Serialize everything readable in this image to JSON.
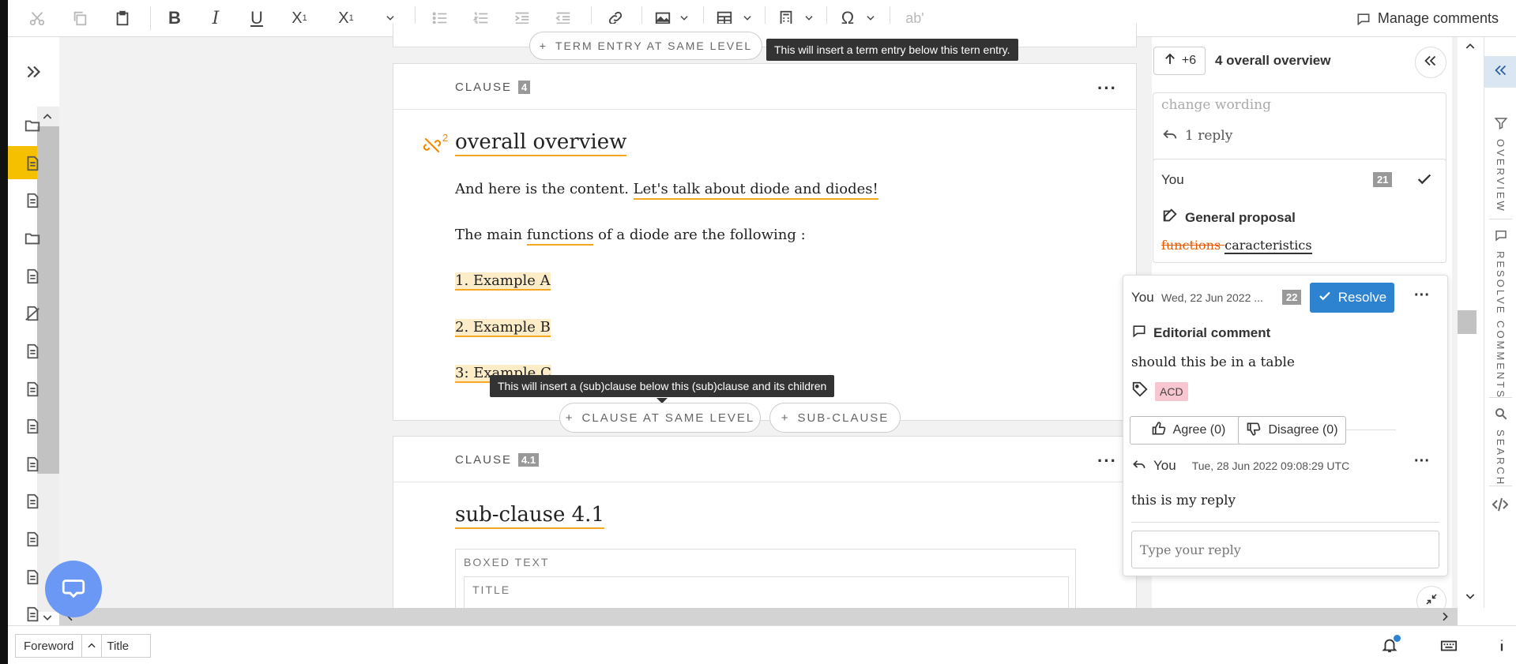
{
  "toolbar": {
    "manage_comments": "Manage comments",
    "superscript_mark": "1",
    "ab_mark": "ab'",
    "items": [
      "cut-icon",
      "copy-icon",
      "paste-icon",
      "bold-icon",
      "italic-icon",
      "underline-icon",
      "subscript-icon",
      "superscript-icon",
      "more-icon",
      "bullet-list-icon",
      "numbered-list-icon",
      "indent-icon",
      "outdent-icon",
      "link-icon",
      "image-icon",
      "table-icon",
      "calculator-icon",
      "special-char-icon",
      "spellcheck-icon"
    ]
  },
  "editor": {
    "term_entry_button": "TERM ENTRY AT SAME LEVEL",
    "term_tooltip": "This will insert a term entry below this tern entry.",
    "clause4": {
      "label": "CLAUSE",
      "number": "4",
      "link_mark": "2",
      "title": "overall overview",
      "p1_plain": "And here is the content. ",
      "p1_highlight": "Let's talk about diode and diodes!",
      "p2_before": "The main ",
      "p2_highlight": "functions",
      "p2_after": " of a diode are the following :",
      "items": [
        "1. Example A",
        "2. Example B",
        "3: Example C"
      ],
      "tooltip": "This will insert a (sub)clause below this (sub)clause and its children",
      "btn_same_level": "CLAUSE AT SAME LEVEL",
      "btn_sub": "SUB-CLAUSE"
    },
    "clause41": {
      "label": "CLAUSE",
      "number": "4.1",
      "title": "sub-clause 4.1",
      "boxed_label": "BOXED TEXT",
      "title_field": "TITLE"
    }
  },
  "comments": {
    "header_count": "+6",
    "header_title": "4 overall overview",
    "prev_snippet": "change wording",
    "prev_reply": "1 reply",
    "proposal": {
      "author": "You",
      "number": "21",
      "type": "General proposal",
      "deleted": "functions ",
      "inserted": "caracteristics"
    },
    "active": {
      "author": "You",
      "date": "Wed, 22 Jun 2022 ...",
      "number": "22",
      "resolve": "Resolve",
      "type": "Editorial comment",
      "text": "should this be in a table",
      "tag": "ACD",
      "agree": "Agree (0)",
      "disagree": "Disagree (0)",
      "reply_author": "You",
      "reply_date": "Tue, 28 Jun 2022 09:08:29 UTC",
      "reply_text": "this is my reply",
      "reply_placeholder": "Type your reply"
    }
  },
  "sidetabs": [
    "OVERVIEW",
    "RESOLVE COMMENTS",
    "SEARCH"
  ],
  "status": {
    "crumb1": "Foreword",
    "crumb2": "Title"
  },
  "colors": {
    "accent_yellow": "#f5c000",
    "underline_orange": "#f5a623",
    "resolve_blue": "#2e83d0",
    "tag_pink": "#f7c6d0",
    "fab_blue": "#6b97f5"
  }
}
